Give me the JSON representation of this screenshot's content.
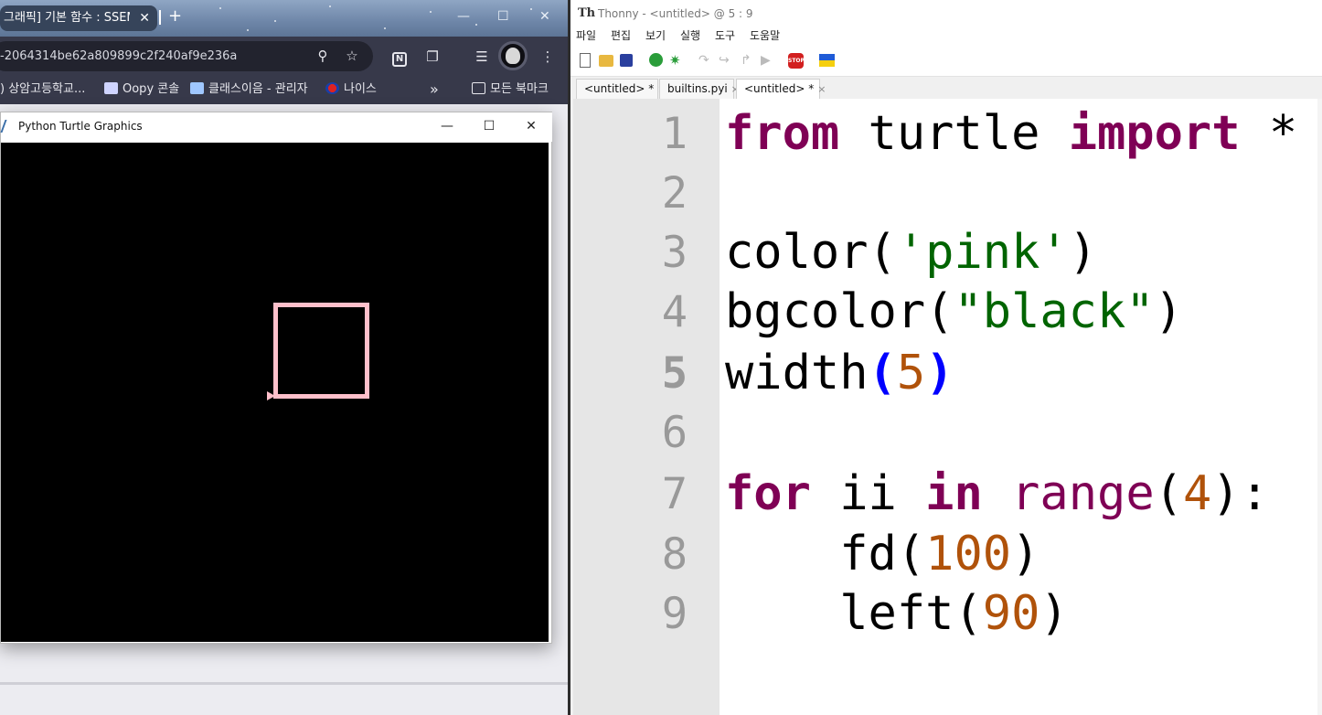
{
  "browser": {
    "tab_title": "그래픽] 기본 함수 : SSEM",
    "tab_close": "✕",
    "new_tab": "+",
    "window_min": "—",
    "window_max": "☐",
    "window_close": "✕",
    "url": "-2064314be62a809899c2f240af9e236a",
    "bookmarks": [
      {
        "label": ") 상암고등학교..."
      },
      {
        "label": "Oopy 콘솔"
      },
      {
        "label": "클래스이음 - 관리자"
      },
      {
        "label": "나이스"
      }
    ],
    "bookmarks_more": "»",
    "bookmarks_all": "모든 북마크"
  },
  "turtle": {
    "title": "Python Turtle Graphics",
    "min": "—",
    "max": "☐",
    "close": "✕",
    "pen_color": "#ffc0cb",
    "bg_color": "#000000"
  },
  "thonny": {
    "title": "Thonny  -  <untitled>  @  5 : 9",
    "menu": [
      "파일",
      "편집",
      "보기",
      "실행",
      "도구",
      "도움말"
    ],
    "tabs": [
      {
        "label": "<untitled>  *"
      },
      {
        "label": "builtins.pyi"
      },
      {
        "label": "<untitled>  *"
      }
    ],
    "tab_close": "×",
    "line_numbers": [
      "1",
      "2",
      "3",
      "4",
      "5",
      "6",
      "7",
      "8",
      "9"
    ],
    "code": {
      "l1_kw1": "from",
      "l1_mod": " turtle ",
      "l1_kw2": "import",
      "l1_star": " *",
      "l3_fn": "color(",
      "l3_str": "'pink'",
      "l3_end": ")",
      "l4_fn": "bgcolor(",
      "l4_str": "\"black\"",
      "l4_end": ")",
      "l5_fn": "width",
      "l5_open": "(",
      "l5_num": "5",
      "l5_close": ")",
      "l7_kw1": "for",
      "l7_var": " ii ",
      "l7_kw2": "in",
      "l7_sp": " ",
      "l7_fn": "range",
      "l7_open": "(",
      "l7_num": "4",
      "l7_end": "):",
      "l8_fn": "    fd(",
      "l8_num": "100",
      "l8_end": ")",
      "l9_fn": "    left(",
      "l9_num": "90",
      "l9_end": ")"
    }
  }
}
